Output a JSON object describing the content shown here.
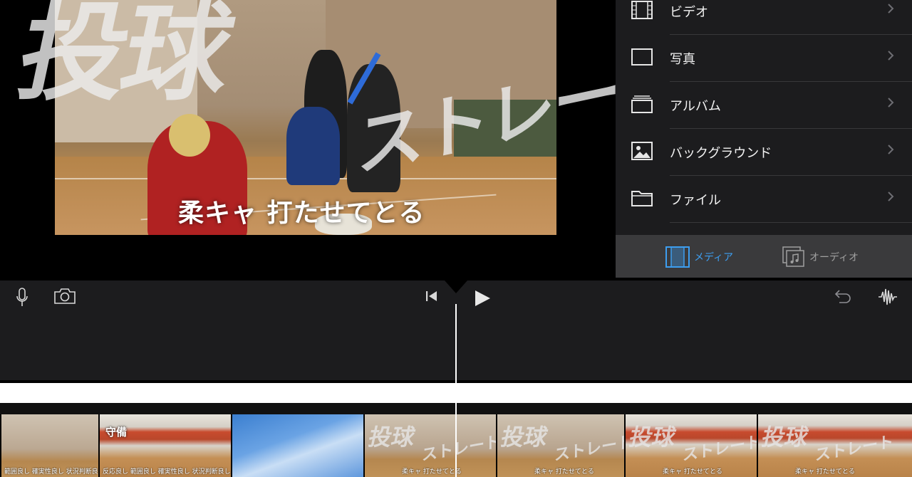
{
  "preview": {
    "overlay_title_1": "投球",
    "overlay_title_2": "ストレート",
    "caption": "柔キャ 打たせてとる"
  },
  "media_menu": {
    "items": [
      {
        "label": "ビデオ",
        "icon": "film-icon"
      },
      {
        "label": "写真",
        "icon": "photo-frame-icon"
      },
      {
        "label": "アルバム",
        "icon": "album-stack-icon"
      },
      {
        "label": "バックグラウンド",
        "icon": "landscape-image-icon"
      },
      {
        "label": "ファイル",
        "icon": "folder-icon"
      }
    ]
  },
  "tabs": {
    "media_label": "メディア",
    "audio_label": "オーディオ",
    "active": "media",
    "active_color": "#3d9ef0"
  },
  "toolbar": {
    "icons": [
      "microphone-icon",
      "camera-icon",
      "skip-to-start-icon",
      "play-icon",
      "undo-icon",
      "audio-waveform-icon"
    ]
  },
  "timeline": {
    "clips": [
      {
        "caption": "範囲良し 確実性良し 状況判断良し",
        "label": ""
      },
      {
        "caption": "反応良し 範囲良し 確実性良し 状況判断良し",
        "label": "守備"
      },
      {
        "caption": "",
        "label": ""
      },
      {
        "caption": "柔キャ 打たせてとる",
        "label": "",
        "big1": "投球",
        "big2": "ストレート"
      },
      {
        "caption": "柔キャ 打たせてとる",
        "label": "",
        "big1": "投球",
        "big2": "ストレート"
      },
      {
        "caption": "柔キャ 打たせてとる",
        "label": "",
        "big1": "投球",
        "big2": "ストレート"
      },
      {
        "caption": "柔キャ 打たせてとる",
        "label": "",
        "big1": "投球",
        "big2": "ストレート"
      }
    ]
  }
}
